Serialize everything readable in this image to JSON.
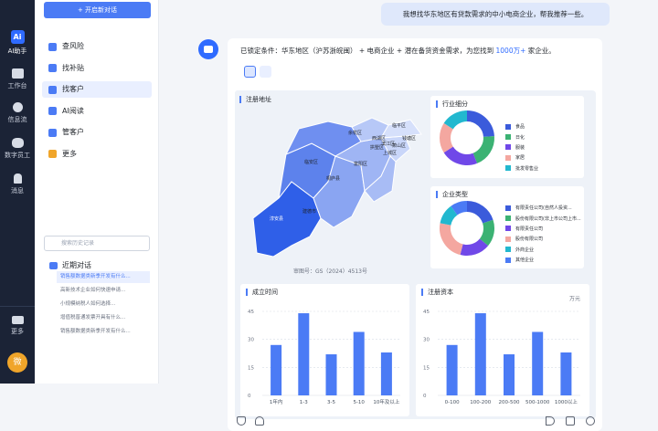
{
  "rail": {
    "items": [
      {
        "label": "AI助手",
        "icon": "ai-logo"
      },
      {
        "label": "工作台",
        "icon": "monitor-icon"
      },
      {
        "label": "信息流",
        "icon": "compass-icon"
      },
      {
        "label": "数字员工",
        "icon": "robot-icon"
      },
      {
        "label": "消息",
        "icon": "bell-icon"
      },
      {
        "label": "更多",
        "icon": "menu-icon"
      }
    ],
    "logo_text": "Ai",
    "avatar_text": "微"
  },
  "sidebar": {
    "new_button": "+ 开启新对话",
    "menu": [
      {
        "label": "查风险",
        "icon": "shield-icon",
        "color": "#4b7bf5"
      },
      {
        "label": "找补贴",
        "icon": "subsidy-icon",
        "color": "#4b7bf5"
      },
      {
        "label": "找客户",
        "icon": "user-icon",
        "color": "#4b7bf5"
      },
      {
        "label": "AI阅读",
        "icon": "reader-icon",
        "color": "#4b7bf5"
      },
      {
        "label": "管客户",
        "icon": "manage-icon",
        "color": "#4b7bf5"
      },
      {
        "label": "更多",
        "icon": "grid-icon",
        "color": "#f0a52a"
      }
    ],
    "search_placeholder": "搜索历史记录",
    "recent_title": "近期对话",
    "recent": [
      "销售额数据类新季开发有什么...",
      "高新技术企业如何快速申请...",
      "小规模纳税人如何选择...",
      "增值税普通发票开具有什么...",
      "销售额数据类新季开发有什么..."
    ]
  },
  "chat": {
    "user_message": "我想找华东地区有贷款需求的中小电商企业，帮我推荐一些。",
    "answer_prefix": "已锁定条件：华东地区（沪苏浙皖闽） + 电商企业 + 潜在备货资金需求，为您找到",
    "answer_count": "1000万+",
    "answer_suffix": "家企业。"
  },
  "map": {
    "title": "注册地址",
    "approval": "审图号：GS（2024）4513号",
    "labels": [
      "余杭区",
      "临平区",
      "西湖区",
      "拱墅区",
      "钱塘区",
      "上城区",
      "滨江区",
      "萧山区",
      "富阳区",
      "桐庐县",
      "建德市",
      "淳安县",
      "临安区"
    ]
  },
  "industry": {
    "title": "行业细分",
    "legend": [
      {
        "label": "食品",
        "color": "#3b5bdb"
      },
      {
        "label": "日化",
        "color": "#3bb273"
      },
      {
        "label": "服装",
        "color": "#7048e8"
      },
      {
        "label": "家居",
        "color": "#f4a7a0"
      },
      {
        "label": "批发零售业",
        "color": "#22b8cf"
      }
    ],
    "values": [
      24,
      20,
      22,
      18,
      16
    ]
  },
  "company": {
    "title": "企业类型",
    "legend": [
      {
        "label": "有限责任公司(自然人投资...",
        "color": "#3b5bdb"
      },
      {
        "label": "股份有限公司(非上市公司上市...",
        "color": "#3bb273"
      },
      {
        "label": "有限责任公司",
        "color": "#7048e8"
      },
      {
        "label": "股份有限公司",
        "color": "#f4a7a0"
      },
      {
        "label": "外商企业",
        "color": "#22b8cf"
      },
      {
        "label": "其他企业",
        "color": "#4b7bf5"
      }
    ],
    "values": [
      20,
      16,
      18,
      24,
      12,
      10
    ]
  },
  "chart_data": [
    {
      "type": "bar",
      "title": "成立时间",
      "categories": [
        "1年内",
        "1-3",
        "3-5",
        "5-10",
        "10年及以上"
      ],
      "values": [
        27,
        44,
        22,
        34,
        23
      ],
      "ylim": [
        0,
        45
      ],
      "yticks": [
        0,
        15,
        30,
        45
      ]
    },
    {
      "type": "bar",
      "title": "注册资本",
      "unit": "万元",
      "categories": [
        "0-100",
        "100-200",
        "200-500",
        "500-1000",
        "1000以上"
      ],
      "values": [
        27,
        44,
        22,
        34,
        23
      ],
      "ylim": [
        0,
        45
      ],
      "yticks": [
        0,
        15,
        30,
        45
      ]
    }
  ],
  "colors": {
    "accent": "#4b7bf5",
    "bar": "#4b7bf5"
  }
}
